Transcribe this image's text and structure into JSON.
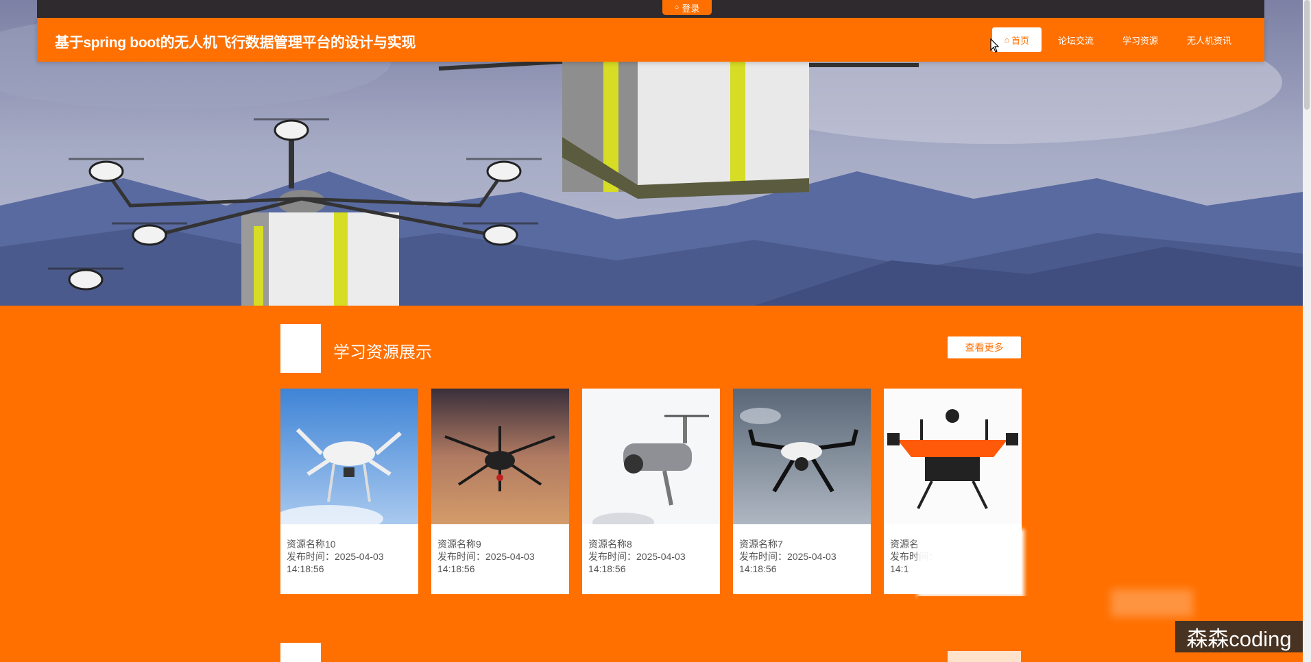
{
  "topbar": {
    "login_label": "登录",
    "login_icon": "user-icon"
  },
  "header": {
    "site_title": "基于spring boot的无人机飞行数据管理平台的设计与实现",
    "nav": [
      {
        "label": "首页",
        "active": true,
        "icon": "home-icon"
      },
      {
        "label": "论坛交流",
        "active": false
      },
      {
        "label": "学习资源",
        "active": false
      },
      {
        "label": "无人机资讯",
        "active": false
      }
    ]
  },
  "colors": {
    "accent": "#ff7000",
    "topbar": "#2e2a2e"
  },
  "section1": {
    "title": "学习资源展示",
    "more_label": "查看更多",
    "time_prefix": "发布时间：",
    "items": [
      {
        "name": "资源名称10",
        "time": "2025-04-03",
        "clock": "14:18:56"
      },
      {
        "name": "资源名称9",
        "time": "2025-04-03",
        "clock": "14:18:56"
      },
      {
        "name": "资源名称8",
        "time": "2025-04-03",
        "clock": "14:18:56"
      },
      {
        "name": "资源名称7",
        "time": "2025-04-03",
        "clock": "14:18:56"
      },
      {
        "name": "资源名",
        "time": "",
        "clock": "14:1"
      }
    ]
  },
  "watermark": "森森coding"
}
